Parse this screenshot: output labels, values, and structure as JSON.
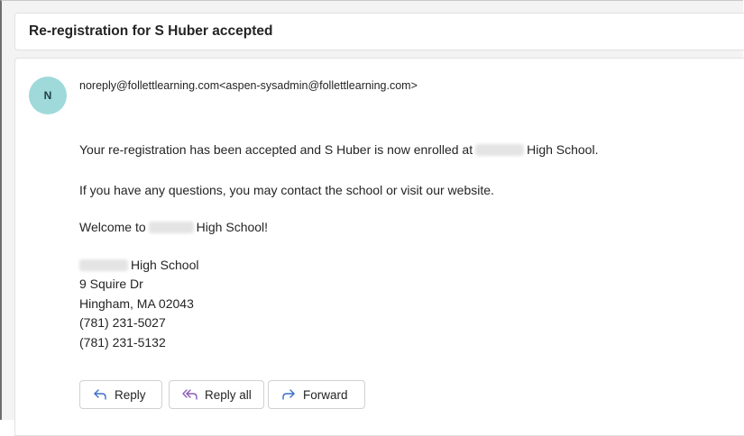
{
  "subject": "Re-registration for S Huber accepted",
  "sender": {
    "avatar_initial": "N",
    "from": "noreply@follettlearning.com<aspen-sysadmin@follettlearning.com>"
  },
  "body": {
    "line1_before": "Your re-registration has been accepted and S Huber is now enrolled at",
    "line1_after": "High School.",
    "line2": "If you have any questions, you may contact the school or visit our website.",
    "line3_before": "Welcome to",
    "line3_after": "High School!"
  },
  "signature": {
    "school_suffix": "High School",
    "street": "9 Squire Dr",
    "city": "Hingham, MA 02043",
    "phone1": "(781) 231-5027",
    "phone2": "(781) 231-5132"
  },
  "actions": {
    "reply": "Reply",
    "reply_all": "Reply all",
    "forward": "Forward"
  },
  "colors": {
    "avatar_bg": "#9fd9da",
    "icon_accent": "#3b6fc7",
    "reply_all_icon": "#8a5bb5"
  },
  "icons": [
    "reply-icon",
    "reply-all-icon",
    "forward-icon"
  ]
}
